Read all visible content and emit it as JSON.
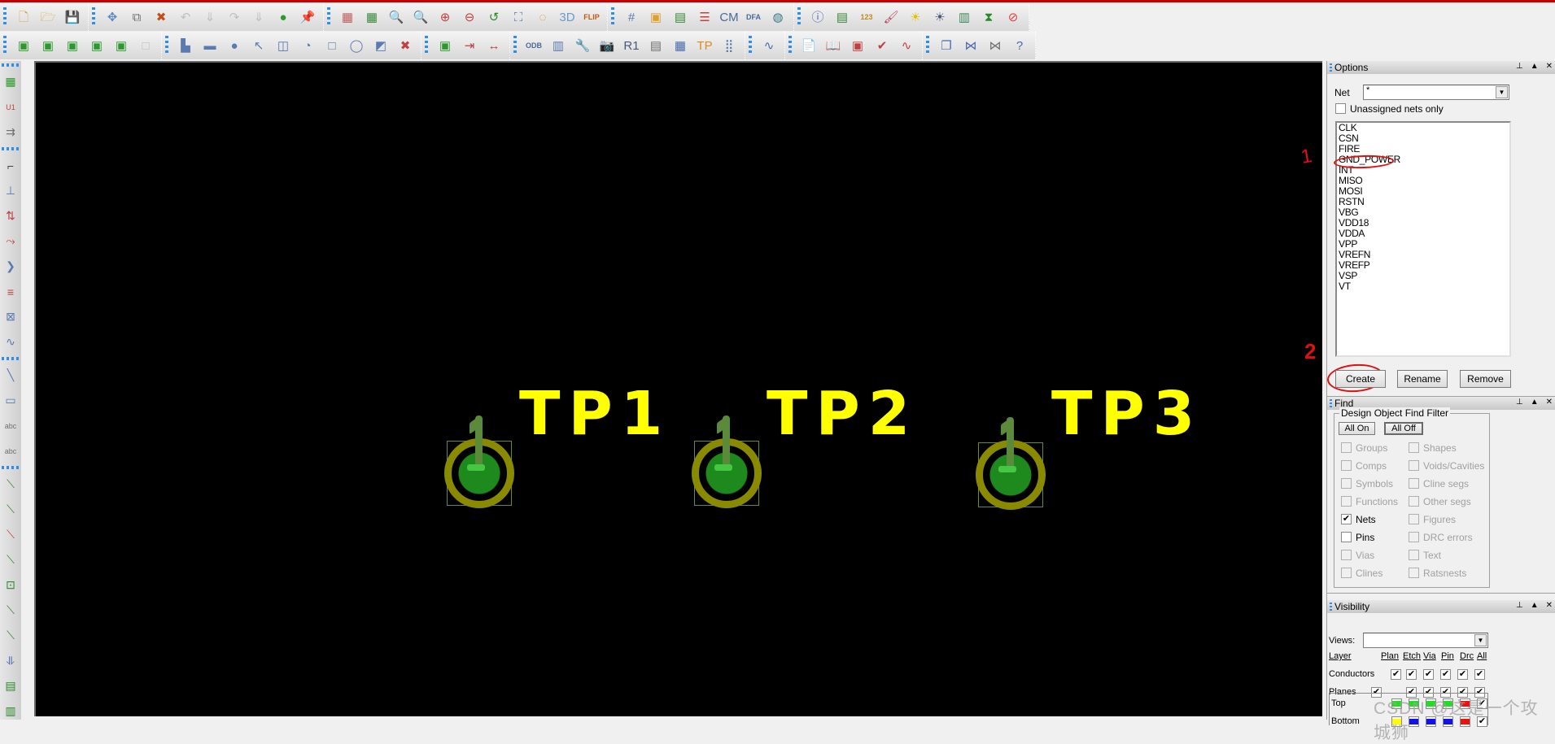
{
  "toolbar": {
    "row1": [
      {
        "name": "new-file-icon",
        "glyph": "🗋",
        "color": "#d9a53b"
      },
      {
        "name": "open-folder-icon",
        "glyph": "🗁",
        "color": "#d9a53b"
      },
      {
        "name": "save-icon",
        "glyph": "💾",
        "color": "#4b6cae"
      },
      {
        "sep": true
      },
      {
        "name": "move-icon",
        "glyph": "✥",
        "color": "#5a8ac0"
      },
      {
        "name": "copy-icon",
        "glyph": "⧉",
        "color": "#707070"
      },
      {
        "name": "delete-icon",
        "glyph": "✖",
        "color": "#c0501a"
      },
      {
        "name": "undo-icon",
        "glyph": "↶",
        "color": "#909090",
        "disabled": true
      },
      {
        "name": "undo-list-icon",
        "glyph": "⇓",
        "color": "#909090",
        "disabled": true
      },
      {
        "name": "redo-icon",
        "glyph": "↷",
        "color": "#909090",
        "disabled": true
      },
      {
        "name": "redo-list-icon",
        "glyph": "⇓",
        "color": "#909090",
        "disabled": true
      },
      {
        "name": "shape-leaf-icon",
        "glyph": "●",
        "color": "#2a9a2a"
      },
      {
        "name": "pin-icon",
        "glyph": "📌",
        "color": "#2a9a2a"
      },
      {
        "sep": true
      },
      {
        "name": "unrats-all-icon",
        "glyph": "▦",
        "color": "#c06060"
      },
      {
        "name": "rats-all-icon",
        "glyph": "▦",
        "color": "#3a8a3a"
      },
      {
        "name": "zoom-points-icon",
        "glyph": "🔍",
        "color": "#5a7ab0"
      },
      {
        "name": "zoom-fit-icon",
        "glyph": "🔍",
        "color": "#c04040"
      },
      {
        "name": "zoom-in-icon",
        "glyph": "⊕",
        "color": "#c04040"
      },
      {
        "name": "zoom-out-icon",
        "glyph": "⊖",
        "color": "#c04040"
      },
      {
        "name": "zoom-previous-icon",
        "glyph": "↺",
        "color": "#2a8a2a"
      },
      {
        "name": "zoom-world-icon",
        "glyph": "⛶",
        "color": "#5a7ab0"
      },
      {
        "name": "redraw-icon",
        "glyph": "◌",
        "color": "#e08a20"
      },
      {
        "name": "3d-view-icon",
        "glyph": "3D",
        "color": "#6a9ad0"
      },
      {
        "name": "flip-design-icon",
        "glyph": "FLIP",
        "color": "#c05a1a"
      },
      {
        "sep": true
      },
      {
        "name": "grid-toggle-icon",
        "glyph": "#",
        "color": "#5a7ab0"
      },
      {
        "name": "color-icon",
        "glyph": "▣",
        "color": "#e0a030"
      },
      {
        "name": "layer-priority-icon",
        "glyph": "▤",
        "color": "#3a8a3a"
      },
      {
        "name": "layers-stack-icon",
        "glyph": "☰",
        "color": "#c04040"
      },
      {
        "name": "constraint-manager-icon",
        "glyph": "CM",
        "color": "#4a6a9a"
      },
      {
        "name": "dfa-icon",
        "glyph": "DFA",
        "color": "#4a6a9a"
      },
      {
        "name": "globe-icon",
        "glyph": "◍",
        "color": "#3a7a8a"
      },
      {
        "sep": true
      },
      {
        "name": "info-icon",
        "glyph": "ⓘ",
        "color": "#4a6ab0"
      },
      {
        "name": "show-element-icon",
        "glyph": "▤",
        "color": "#3a8a3a"
      },
      {
        "name": "measure-icon",
        "glyph": "123",
        "color": "#c08a20"
      },
      {
        "name": "brush-icon",
        "glyph": "🖌",
        "color": "#c04060"
      },
      {
        "name": "highlight-icon",
        "glyph": "☀",
        "color": "#e0c000"
      },
      {
        "name": "dehighlight-icon",
        "glyph": "☀",
        "color": "#4a5a7a"
      },
      {
        "name": "assign-color-icon",
        "glyph": "▥",
        "color": "#3a8a5a"
      },
      {
        "name": "hourglass-icon",
        "glyph": "⧗",
        "color": "#2a8a2a"
      },
      {
        "name": "no-select-icon",
        "glyph": "⊘",
        "color": "#e04040"
      }
    ],
    "row2": [
      {
        "name": "place-manual-icon",
        "glyph": "▣",
        "color": "#2a9a2a"
      },
      {
        "name": "place-components-icon",
        "glyph": "▣",
        "color": "#2a9a2a"
      },
      {
        "name": "swap-pins-icon",
        "glyph": "▣",
        "color": "#2a9a2a"
      },
      {
        "name": "spread-icon",
        "glyph": "▣",
        "color": "#2a9a2a"
      },
      {
        "name": "signal-integrity-icon",
        "glyph": "▣",
        "color": "#2a9a2a"
      },
      {
        "name": "blank-disabled-icon",
        "glyph": "□",
        "color": "#909090",
        "disabled": true
      },
      {
        "sep": true
      },
      {
        "name": "shape-polygon-icon",
        "glyph": "▙",
        "color": "#5a7ab0"
      },
      {
        "name": "shape-rect-icon",
        "glyph": "▬",
        "color": "#5a7ab0"
      },
      {
        "name": "shape-circle-icon",
        "glyph": "●",
        "color": "#5a7ab0"
      },
      {
        "name": "select-shape-icon",
        "glyph": "↖",
        "color": "#5a7ab0"
      },
      {
        "name": "manual-void-icon",
        "glyph": "◫",
        "color": "#5a7ab0"
      },
      {
        "name": "void-circle-icon",
        "glyph": "◔",
        "color": "#5a7ab0"
      },
      {
        "name": "void-rect-icon",
        "glyph": "□",
        "color": "#5a7ab0"
      },
      {
        "name": "void-circle2-icon",
        "glyph": "◯",
        "color": "#5a7ab0"
      },
      {
        "name": "edit-boundary-icon",
        "glyph": "◩",
        "color": "#5a7ab0"
      },
      {
        "name": "delete-island-icon",
        "glyph": "✖",
        "color": "#c04040"
      },
      {
        "sep": true
      },
      {
        "name": "testpoint-board-icon",
        "glyph": "▣",
        "color": "#2a9a2a"
      },
      {
        "name": "dimension-icon",
        "glyph": "⇥",
        "color": "#c04040"
      },
      {
        "name": "measure-line-icon",
        "glyph": "↔",
        "color": "#c04040"
      },
      {
        "sep": true
      },
      {
        "name": "odb-export-icon",
        "glyph": "ODB",
        "color": "#4a6a9a"
      },
      {
        "name": "padstack-icon",
        "glyph": "▥",
        "color": "#5a7ab0"
      },
      {
        "name": "padstack-edit-icon",
        "glyph": "🔧",
        "color": "#707070"
      },
      {
        "name": "camera-icon",
        "glyph": "📷",
        "color": "#707070"
      },
      {
        "name": "rename-refdes-icon",
        "glyph": "R1",
        "color": "#4a5a7a"
      },
      {
        "name": "device-list-icon",
        "glyph": "▤",
        "color": "#707070"
      },
      {
        "name": "grid-matrix-icon",
        "glyph": "▦",
        "color": "#4a6ab0"
      },
      {
        "name": "testpoint-icon",
        "glyph": "TP",
        "color": "#e08a20"
      },
      {
        "name": "array-icon",
        "glyph": "⣿",
        "color": "#5a7ab0"
      },
      {
        "sep": true
      },
      {
        "name": "waveform-icon",
        "glyph": "∿",
        "color": "#4a6ab0"
      },
      {
        "sep": true
      },
      {
        "name": "si-report-icon",
        "glyph": "📄",
        "color": "#c04040"
      },
      {
        "name": "si-library-icon",
        "glyph": "📖",
        "color": "#c04040"
      },
      {
        "name": "si-model-icon",
        "glyph": "▣",
        "color": "#c04040"
      },
      {
        "name": "si-audit-icon",
        "glyph": "✔",
        "color": "#c04040"
      },
      {
        "name": "si-probe-icon",
        "glyph": "∿",
        "color": "#c04040"
      },
      {
        "sep": true
      },
      {
        "name": "windows-icon",
        "glyph": "❐",
        "color": "#4a6ab0"
      },
      {
        "name": "net-schedule-icon",
        "glyph": "⋈",
        "color": "#4a6ab0"
      },
      {
        "name": "bundle-icon",
        "glyph": "⋈",
        "color": "#707070"
      },
      {
        "name": "help-icon",
        "glyph": "?",
        "color": "#4a6ab0"
      }
    ]
  },
  "left_toolbar": [
    {
      "name": "place-manual-icon",
      "glyph": "▦",
      "color": "#2a9a2a"
    },
    {
      "name": "refdes-u1-icon",
      "glyph": "U1",
      "color": "#c04040"
    },
    {
      "name": "swap-component-icon",
      "glyph": "⇉",
      "color": "#707070"
    },
    {
      "sep": true
    },
    {
      "name": "add-connect-icon",
      "glyph": "⌐",
      "color": "#404040"
    },
    {
      "name": "slide-icon",
      "glyph": "⊥",
      "color": "#5a7ab0"
    },
    {
      "name": "delay-tune-icon",
      "glyph": "⇅",
      "color": "#c04040"
    },
    {
      "name": "custom-smooth-icon",
      "glyph": "⤳",
      "color": "#c04040"
    },
    {
      "name": "vertex-icon",
      "glyph": "❯",
      "color": "#5a7ab0"
    },
    {
      "name": "multi-route-icon",
      "glyph": "≡",
      "color": "#c04040"
    },
    {
      "name": "fanout-icon",
      "glyph": "⊠",
      "color": "#5a7ab0"
    },
    {
      "name": "route-wave-icon",
      "glyph": "∿",
      "color": "#5a7ab0"
    },
    {
      "sep": true
    },
    {
      "name": "add-line-icon",
      "glyph": "╲",
      "color": "#5a7ab0"
    },
    {
      "name": "add-rect-icon",
      "glyph": "▭",
      "color": "#5a7ab0"
    },
    {
      "name": "add-text-icon",
      "glyph": "abc",
      "color": "#707070"
    },
    {
      "name": "edit-text-icon",
      "glyph": "abc",
      "color": "#707070"
    },
    {
      "sep": true
    },
    {
      "name": "show-rats-icon",
      "glyph": "⟍",
      "color": "#2a8a2a"
    },
    {
      "name": "rats-net-icon",
      "glyph": "⟍",
      "color": "#2a8a2a"
    },
    {
      "name": "rats-delete-icon",
      "glyph": "⟍",
      "color": "#c04040"
    },
    {
      "name": "rats-edit-icon",
      "glyph": "⟍",
      "color": "#2a8a2a"
    },
    {
      "name": "rats-resize-icon",
      "glyph": "⊡",
      "color": "#2a8a2a"
    },
    {
      "name": "rats-report-icon",
      "glyph": "⟍",
      "color": "#2a8a2a"
    },
    {
      "name": "rats-shadow-icon",
      "glyph": "⟍",
      "color": "#2a8a2a"
    },
    {
      "name": "net-group-icon",
      "glyph": "⥥",
      "color": "#4a6ab0"
    },
    {
      "name": "net-list-icon",
      "glyph": "▤",
      "color": "#2a8a2a"
    },
    {
      "name": "net-status-icon",
      "glyph": "▥",
      "color": "#2a8a2a"
    }
  ],
  "canvas": {
    "testpoints": [
      {
        "label": "TP1",
        "pin": "1"
      },
      {
        "label": "TP2",
        "pin": "1"
      },
      {
        "label": "TP3",
        "pin": "1"
      }
    ]
  },
  "options_panel": {
    "title": "Options",
    "net_label": "Net",
    "net_value": "*",
    "unassigned_label": "Unassigned nets only",
    "unassigned_checked": false,
    "nets": [
      "CLK",
      "CSN",
      "FIRE",
      "GND_POWER",
      "INT",
      "MISO",
      "MOSI",
      "RSTN",
      "VBG",
      "VDD18",
      "VDDA",
      "VPP",
      "VREFN",
      "VREFP",
      "VSP",
      "VT"
    ],
    "highlighted_net": "GND_POWER",
    "buttons": {
      "create": "Create",
      "rename": "Rename",
      "remove": "Remove"
    },
    "annotations": {
      "step1": "1",
      "step2": "2"
    }
  },
  "find_panel": {
    "title": "Find",
    "filter_title": "Design Object Find Filter",
    "all_on": "All On",
    "all_off": "All Off",
    "left": [
      {
        "label": "Groups",
        "checked": false,
        "enabled": false
      },
      {
        "label": "Comps",
        "checked": false,
        "enabled": false
      },
      {
        "label": "Symbols",
        "checked": false,
        "enabled": false
      },
      {
        "label": "Functions",
        "checked": false,
        "enabled": false
      },
      {
        "label": "Nets",
        "checked": true,
        "enabled": true
      },
      {
        "label": "Pins",
        "checked": false,
        "enabled": true
      },
      {
        "label": "Vias",
        "checked": false,
        "enabled": false
      },
      {
        "label": "Clines",
        "checked": false,
        "enabled": false
      }
    ],
    "right": [
      {
        "label": "Shapes",
        "checked": false,
        "enabled": false
      },
      {
        "label": "Voids/Cavities",
        "checked": false,
        "enabled": false
      },
      {
        "label": "Cline segs",
        "checked": false,
        "enabled": false
      },
      {
        "label": "Other segs",
        "checked": false,
        "enabled": false
      },
      {
        "label": "Figures",
        "checked": false,
        "enabled": false
      },
      {
        "label": "DRC errors",
        "checked": false,
        "enabled": false
      },
      {
        "label": "Text",
        "checked": false,
        "enabled": false
      },
      {
        "label": "Ratsnests",
        "checked": false,
        "enabled": false
      }
    ]
  },
  "visibility_panel": {
    "title": "Visibility",
    "views_label": "Views:",
    "views_value": "",
    "headers": {
      "layer": "Layer",
      "plan": "Plan",
      "etch": "Etch",
      "via": "Via",
      "pin": "Pin",
      "drc": "Drc",
      "all": "All"
    },
    "rows": [
      {
        "label": "Conductors",
        "plan": null,
        "etch": true,
        "via": true,
        "pin": true,
        "drc": true,
        "all": true,
        "cond_plan": true
      },
      {
        "label": "Planes",
        "plan": true,
        "etch": true,
        "via": true,
        "pin": true,
        "drc": true,
        "all": true
      }
    ],
    "layers": [
      {
        "label": "Top",
        "colors": [
          "#22dd22",
          "#22dd22",
          "#22dd22",
          "#22dd22",
          "#ee1111"
        ],
        "all": true
      },
      {
        "label": "Bottom",
        "colors": [
          "#ffff00",
          "#1111ee",
          "#1111ee",
          "#1111ee",
          "#ee1111"
        ],
        "all": true
      }
    ]
  },
  "watermark": "CSDN @这是一个攻城狮",
  "colors": {
    "accent_red": "#c80000",
    "silkscreen_yellow": "#ffff00",
    "pad_green": "#1e8a1e",
    "annotation_red": "#e01010"
  }
}
